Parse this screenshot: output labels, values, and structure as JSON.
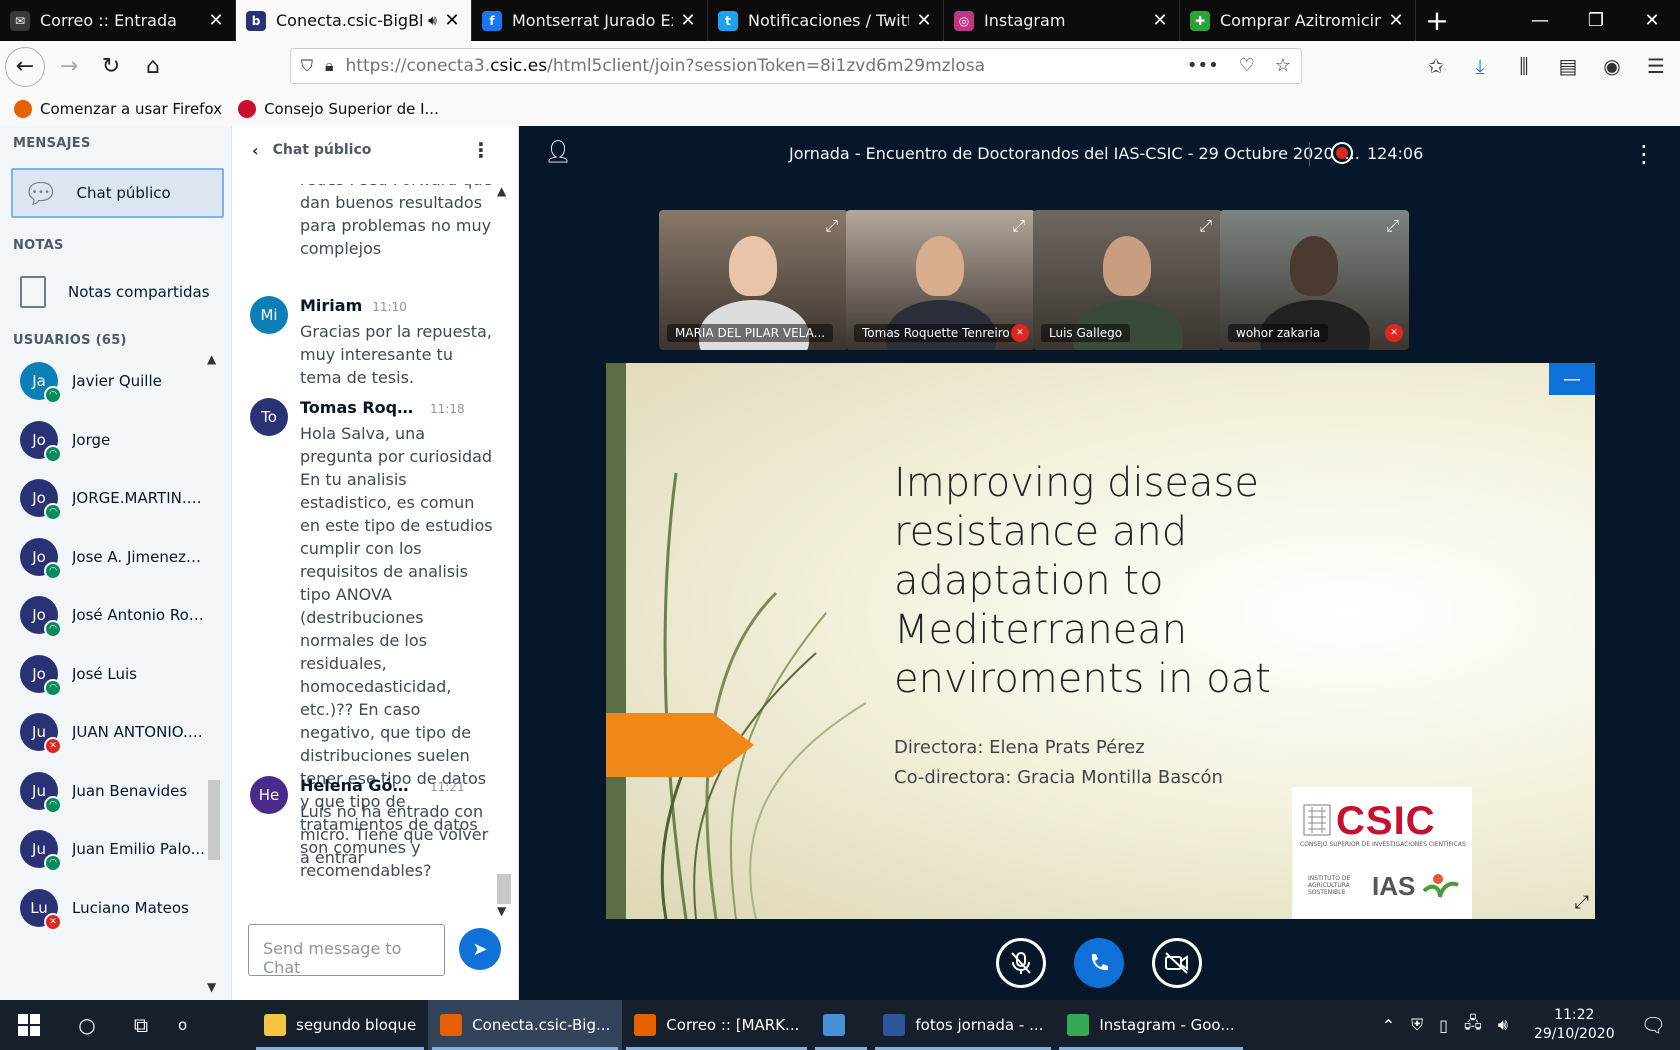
{
  "browser": {
    "tabs": [
      {
        "title": "Correo :: Entrada",
        "color": "#3a3a3a",
        "glyph": "✉"
      },
      {
        "title": "Conecta.csic-BigBlueButton",
        "color": "#283274",
        "glyph": "b",
        "active": true
      },
      {
        "title": "Montserrat Jurado Expósito",
        "color": "#1877f2",
        "glyph": "f"
      },
      {
        "title": "Notificaciones / Twitter",
        "color": "#1da1f2",
        "glyph": "t"
      },
      {
        "title": "Instagram",
        "color": "#c13584",
        "glyph": "◎"
      },
      {
        "title": "Comprar Azitromicina sin receta",
        "color": "#2aa33a",
        "glyph": "✚"
      }
    ],
    "url_prefix": "https://conecta3.",
    "url_host": "csic.es",
    "url_path": "/html5client/join?sessionToken=8i1zvd6m29mzlosa",
    "bookmarks": [
      {
        "label": "Comenzar a usar Firefox",
        "color": "#e66000"
      },
      {
        "label": "Consejo Superior de I...",
        "color": "#c8102e"
      }
    ]
  },
  "sidebar": {
    "messages_heading": "MENSAJES",
    "public_chat": "Chat público",
    "notes_heading": "NOTAS",
    "shared_notes": "Notas compartidas",
    "users_heading": "USUARIOS (65)",
    "users": [
      {
        "initials": "Ja",
        "name": "Javier Quille",
        "color": "#0d7fb8",
        "status": "listen"
      },
      {
        "initials": "Jo",
        "name": "Jorge",
        "color": "#283274",
        "status": "listen"
      },
      {
        "initials": "Jo",
        "name": "JORGE.MARTIN.B...",
        "color": "#283274",
        "status": "listen"
      },
      {
        "initials": "Jo",
        "name": "Jose A. Jimenez-...",
        "color": "#283274",
        "status": "listen"
      },
      {
        "initials": "Jo",
        "name": "José Antonio Rod...",
        "color": "#283274",
        "status": "listen"
      },
      {
        "initials": "Jo",
        "name": "José Luis",
        "color": "#283274",
        "status": "listen"
      },
      {
        "initials": "Ju",
        "name": "JUAN ANTONIO.N...",
        "color": "#283274",
        "status": "muted"
      },
      {
        "initials": "Ju",
        "name": "Juan Benavides",
        "color": "#283274",
        "status": "listen"
      },
      {
        "initials": "Ju",
        "name": "Juan Emilio Palo...",
        "color": "#283274",
        "status": "listen"
      },
      {
        "initials": "Lu",
        "name": "Luciano Mateos",
        "color": "#283274",
        "status": "muted"
      }
    ]
  },
  "chat": {
    "header": "Chat público",
    "messages": [
      {
        "initials": "",
        "name": "",
        "time": "",
        "text": "redes Feed Forward que dan buenos resultados para problemas no muy complejos",
        "color": ""
      },
      {
        "initials": "Mi",
        "name": "Miriam",
        "time": "11:10",
        "text": "Gracias por la repuesta, muy interesante tu tema de tesis.",
        "color": "#0d7fb8"
      },
      {
        "initials": "To",
        "name": "Tomas Roque...",
        "time": "11:18",
        "text": "Hola Salva, una pregunta por curiosidad. En tu analisis estadistico, es comun en este tipo de estudios cumplir con los requisitos de analisis tipo ANOVA (destribuciones normales de los residuales, homocedasticidad, etc.)?? En caso negativo, que tipo de distribuciones suelen tener ese tipo de datos y que tipo de tratamientos de datos son comunes y recomendables?",
        "color": "#283274"
      },
      {
        "initials": "He",
        "name": "Helena Gómez",
        "time": "11:21",
        "text": "Luis no ha entrado con micro. Tiene que volver a entrar",
        "color": "#4a2a8a"
      }
    ],
    "input_placeholder": "Send message to Chat"
  },
  "presentation": {
    "meeting_title": "Jornada - Encuentro de Doctorandos del IAS-CSIC - 29 Octubre 2020 -...",
    "timer": "124:06",
    "videos": [
      {
        "name": "MARIA DEL PILAR VELA...",
        "muted": false
      },
      {
        "name": "Tomas Roquette Tenreiro",
        "muted": true
      },
      {
        "name": "Luis Gallego",
        "muted": false
      },
      {
        "name": "wohor zakaria",
        "muted": true
      }
    ],
    "slide": {
      "title_lines": [
        "Improving disease",
        "resistance and",
        "adaptation to",
        "Mediterranean",
        "enviroments in oat"
      ],
      "director": "Directora: Elena Prats Pérez",
      "codirector": "Co-directora: Gracia Montilla Bascón",
      "logo_csic": "CSIC",
      "logo_csic_sub": "CONSEJO SUPERIOR DE INVESTIGACIONES CIENTÍFICAS",
      "logo_ias": "IAS",
      "logo_ias_sub": "INSTITUTO DE AGRICULTURA SOSTENIBLE"
    }
  },
  "taskbar": {
    "search_label": "o",
    "items": [
      {
        "label": "segundo bloque",
        "color": "#f5c542"
      },
      {
        "label": "Conecta.csic-Big...",
        "color": "#e66000",
        "active": true
      },
      {
        "label": "Correo :: [MARK...",
        "color": "#e66000"
      },
      {
        "label": "",
        "color": "#4a90d9"
      },
      {
        "label": "fotos jornada - ...",
        "color": "#2b579a"
      },
      {
        "label": "Instagram - Goo...",
        "color": "#34a853"
      }
    ],
    "time": "11:22",
    "date": "29/10/2020"
  }
}
